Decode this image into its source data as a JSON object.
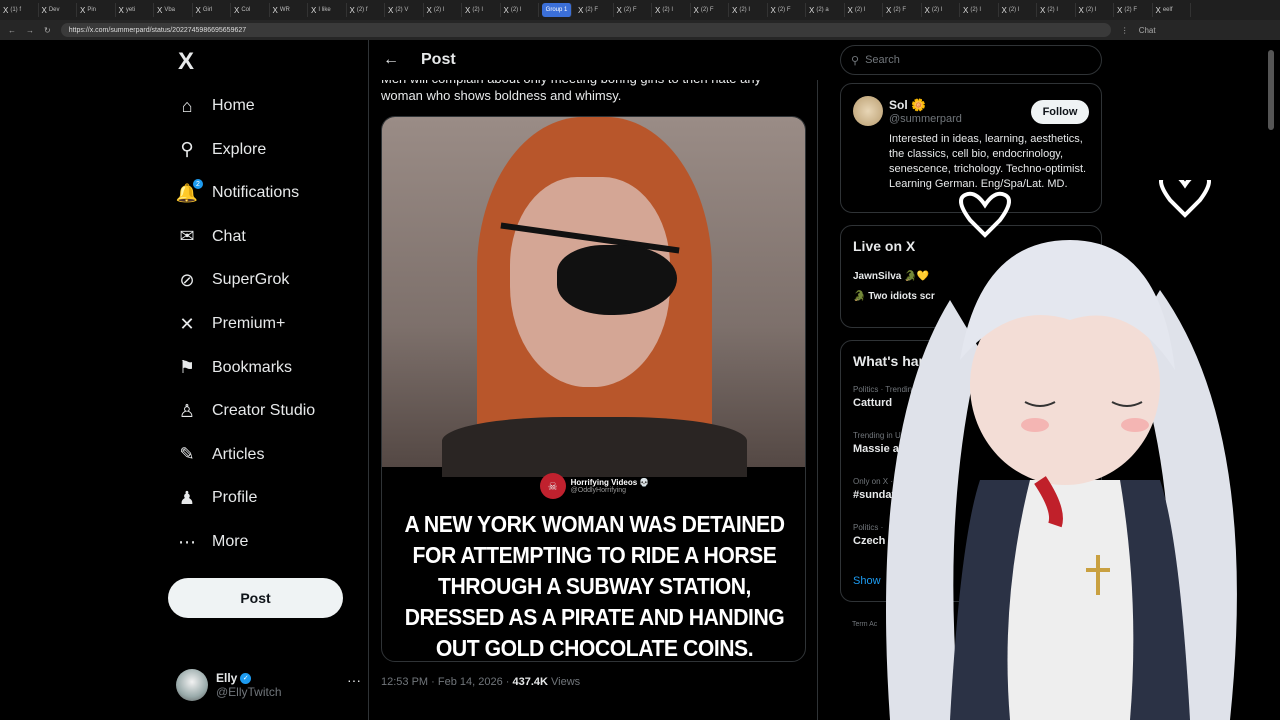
{
  "browser": {
    "tabs": [
      "(1) f",
      "Dev",
      "Pin",
      "yeti",
      "Vba",
      "Girl",
      "Col",
      "WR",
      "I like",
      "(2) f",
      "(2) V",
      "(2) I",
      "(2) I",
      "(2) I"
    ],
    "group_label": "Group 1",
    "tabs_after": [
      "(2) F",
      "(2) F",
      "(2) I",
      "(2) F",
      "(2) I",
      "(2) F",
      "(2) a",
      "(2) I",
      "(2) F",
      "(2) I",
      "(2) I",
      "(2) I",
      "(2) I",
      "(2) I",
      "(2) F"
    ],
    "last_tab": "eelf",
    "url": "https://x.com/summerpard/status/2022745986695659627",
    "chat_label": "Chat"
  },
  "sidebar": {
    "logo": "X",
    "items": [
      {
        "label": "Home",
        "icon": "home-icon",
        "glyph": "⌂"
      },
      {
        "label": "Explore",
        "icon": "search-icon",
        "glyph": "⚲"
      },
      {
        "label": "Notifications",
        "icon": "bell-icon",
        "glyph": "🔔",
        "badge": "2"
      },
      {
        "label": "Chat",
        "icon": "mail-icon",
        "glyph": "✉"
      },
      {
        "label": "SuperGrok",
        "icon": "grok-icon",
        "glyph": "⊘"
      },
      {
        "label": "Premium+",
        "icon": "x-icon",
        "glyph": "✕"
      },
      {
        "label": "Bookmarks",
        "icon": "bookmark-icon",
        "glyph": "⚑"
      },
      {
        "label": "Creator Studio",
        "icon": "creator-icon",
        "glyph": "♙"
      },
      {
        "label": "Articles",
        "icon": "article-icon",
        "glyph": "✎"
      },
      {
        "label": "Profile",
        "icon": "profile-icon",
        "glyph": "♟"
      },
      {
        "label": "More",
        "icon": "more-icon",
        "glyph": "⋯"
      }
    ],
    "post_button": "Post",
    "account": {
      "name": "Elly",
      "handle": "@EllyTwitch",
      "menu": "···"
    }
  },
  "main": {
    "back": "←",
    "title": "Post",
    "text": "Men will complain about only meeting boring girls to then hate any woman who shows boldness and whimsy.",
    "media": {
      "source_name": "Horrifying Videos 💀",
      "source_handle": "@OddlyHorrifying",
      "caption": "A NEW YORK WOMAN WAS DETAINED FOR ATTEMPTING TO RIDE A HORSE THROUGH A SUBWAY STATION, DRESSED AS A PIRATE AND HANDING OUT GOLD CHOCOLATE COINS."
    },
    "time": "12:53 PM · Feb 14, 2026 · ",
    "views_count": "437.4K",
    "views_label": " Views"
  },
  "right": {
    "search_placeholder": "Search",
    "profile": {
      "name": "Sol 🌼",
      "handle": "@summerpard",
      "follow": "Follow",
      "bio": "Interested in ideas, learning, aesthetics, the classics, cell bio, endocrinology, senescence, trichology. Techno-optimist. Learning German. Eng/Spa/Lat. MD."
    },
    "live": {
      "title": "Live on X",
      "line1": "JawnSilva 🐊💛",
      "line2": "🐊 Two idiots scr"
    },
    "trends": {
      "title": "What's hap",
      "items": [
        {
          "meta": "Politics · Trendin",
          "name": "Catturd"
        },
        {
          "meta": "Trending in Un",
          "name": "Massie and"
        },
        {
          "meta": "Only on X · T",
          "name": "#sunday"
        },
        {
          "meta": "Politics · ",
          "name": "Czech"
        }
      ],
      "show_more": "Show"
    },
    "terms": "Term\nAc"
  }
}
